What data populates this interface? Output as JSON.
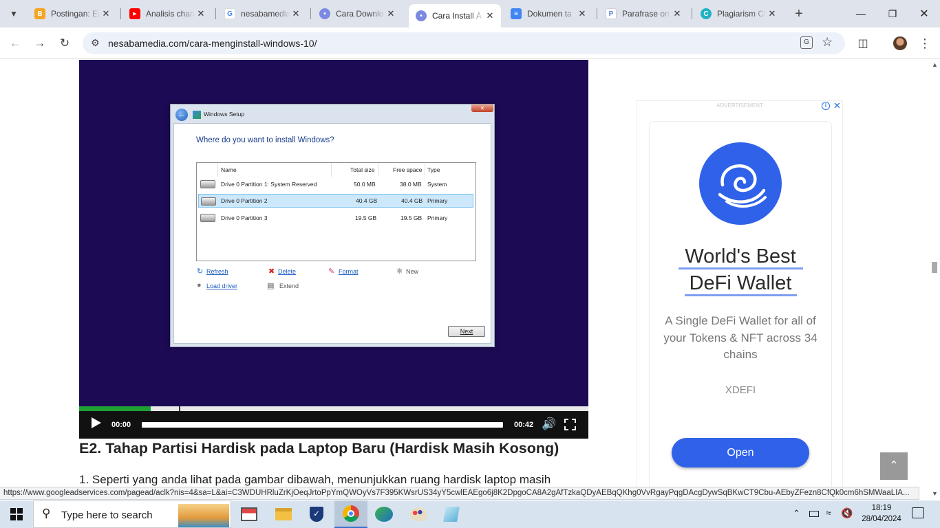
{
  "browser": {
    "tabs": [
      {
        "title": "Postingan: Ed",
        "icon": "blogger-icon",
        "color": "#f4a623"
      },
      {
        "title": "Analisis chan",
        "icon": "youtube-icon",
        "color": "#ff0000"
      },
      {
        "title": "nesabamedia",
        "icon": "google-icon",
        "color": "#4285f4"
      },
      {
        "title": "Cara Downlo",
        "icon": "nesabamedia-icon",
        "color": "#5a6bd6"
      },
      {
        "title": "Cara Install Ā",
        "icon": "nesabamedia-icon",
        "color": "#5a6bd6",
        "active": true
      },
      {
        "title": "Dokumen ta",
        "icon": "docs-icon",
        "color": "#4285f4"
      },
      {
        "title": "Parafrase on",
        "icon": "paraphrase-icon",
        "color": "#5b7fd6"
      },
      {
        "title": "Plagiarism Cl",
        "icon": "plagiarism-icon",
        "color": "#20b2c4"
      }
    ],
    "url": "nesabamedia.com/cara-menginstall-windows-10/"
  },
  "video": {
    "current_time": "00:00",
    "duration": "00:42",
    "buffered_fraction": 0.14,
    "played_fraction": 0.0,
    "setup": {
      "window_title": "Windows Setup",
      "question": "Where do you want to install Windows?",
      "columns": [
        "Name",
        "Total size",
        "Free space",
        "Type"
      ],
      "rows": [
        {
          "name": "Drive 0 Partition 1: System Reserved",
          "total": "50.0 MB",
          "free": "38.0 MB",
          "type": "System"
        },
        {
          "name": "Drive 0 Partition 2",
          "total": "40.4 GB",
          "free": "40.4 GB",
          "type": "Primary",
          "selected": true
        },
        {
          "name": "Drive 0 Partition 3",
          "total": "19.5 GB",
          "free": "19.5 GB",
          "type": "Primary"
        }
      ],
      "actions": {
        "refresh": "Refresh",
        "delete": "Delete",
        "format": "Format",
        "new": "New",
        "load_driver": "Load driver",
        "extend": "Extend"
      },
      "next": "Next"
    }
  },
  "article": {
    "heading": "E2. Tahap Partisi Hardisk pada Laptop Baru (Hardisk Masih Kosong)",
    "paragraph": "1. Seperti yang anda lihat pada gambar dibawah, menunjukkan ruang hardisk laptop masih"
  },
  "ad": {
    "label": "ADVERTISEMENT",
    "headline_1": "World's Best",
    "headline_2": "DeFi Wallet",
    "body": "A Single DeFi Wallet for all of your Tokens & NFT across 34 chains",
    "brand": "XDEFI",
    "cta": "Open",
    "accent": "#2f62e8"
  },
  "status_url": "https://www.googleadservices.com/pagead/aclk?nis=4&sa=L&ai=C3WDUHRluZrKjOeqJrtoPpYmQWOyVs7F395KWsrUS34yY5cwlEAEgo6j8K2DpgoCA8A2gAfTzkaQDyAEBqQKhg0VvRgayPqgDAcgDywSqBKwCT9Cbu-AEbyZFezn8CfQk0cm6hSMWaaLIA...",
  "taskbar": {
    "search_placeholder": "Type here to search",
    "time": "18:19",
    "date": "28/04/2024"
  }
}
